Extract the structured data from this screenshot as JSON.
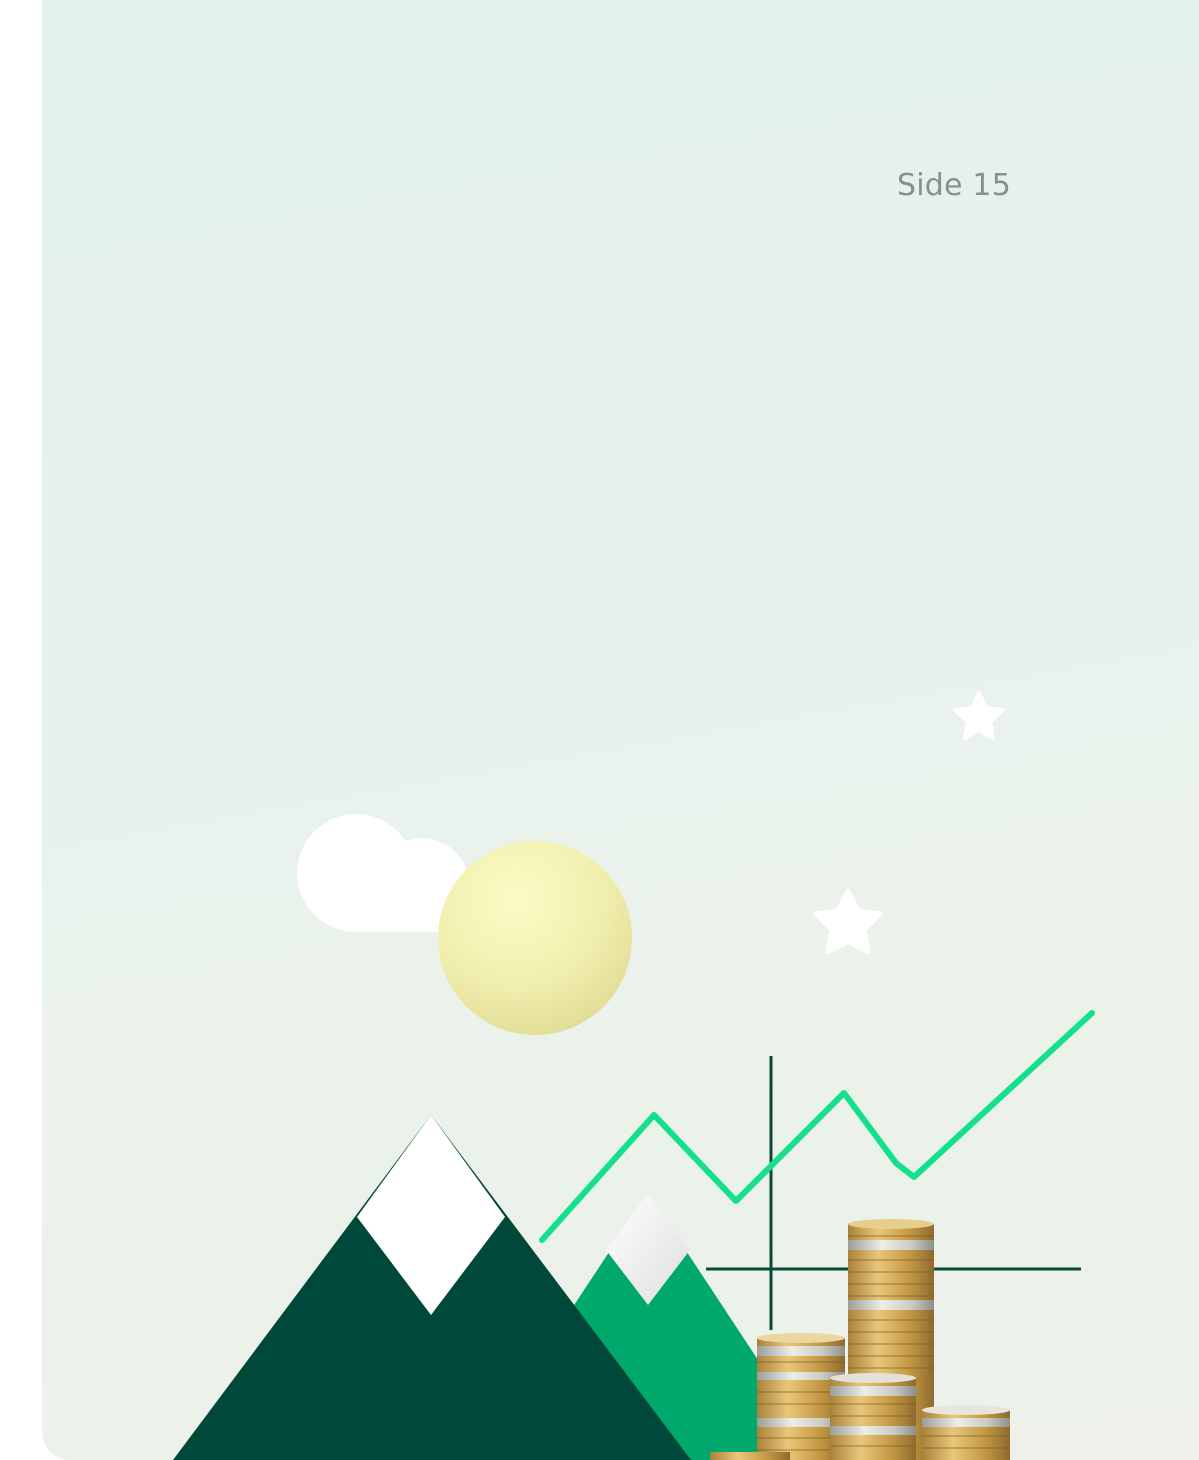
{
  "page": {
    "page_number_label": "Side 15"
  },
  "illustration": {
    "elements": [
      "cloud",
      "sun",
      "star",
      "star",
      "mountain",
      "mountain",
      "trend-line",
      "crosshair",
      "coin-stacks"
    ],
    "colors": {
      "background": "#e3f1ea",
      "mountain_dark": "#00483a",
      "mountain_light": "#00a86b",
      "snow": "#ffffff",
      "sun": "#f4f2b6",
      "trend_line": "#12e08a",
      "crosshair": "#0a4a3a",
      "coin_gold": "#c9a24e",
      "coin_silver": "#cfd0cb"
    }
  }
}
